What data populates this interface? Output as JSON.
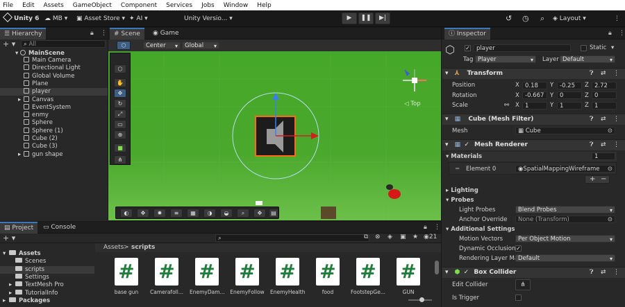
{
  "menu": [
    "File",
    "Edit",
    "Assets",
    "GameObject",
    "Component",
    "Services",
    "Jobs",
    "Window",
    "Help"
  ],
  "toolbar": {
    "unity_label": "Unity 6",
    "account_label": "MB",
    "asset_store_label": "Asset Store",
    "ai_label": "AI",
    "version_label": "Unity Versio...",
    "layout_label": "Layout"
  },
  "hierarchy": {
    "tab": "Hierarchy",
    "search_placeholder": "All",
    "scene_name": "MainScene",
    "items": [
      {
        "label": "Main Camera",
        "expandable": false
      },
      {
        "label": "Directional Light",
        "expandable": false
      },
      {
        "label": "Global Volume",
        "expandable": false
      },
      {
        "label": "Plane",
        "expandable": false
      },
      {
        "label": "player",
        "expandable": false,
        "selected": true
      },
      {
        "label": "Canvas",
        "expandable": true
      },
      {
        "label": "EventSystem",
        "expandable": false
      },
      {
        "label": "enmy",
        "expandable": false
      },
      {
        "label": "Sphere",
        "expandable": false
      },
      {
        "label": "Sphere (1)",
        "expandable": false
      },
      {
        "label": "Cube (2)",
        "expandable": false
      },
      {
        "label": "Cube (3)",
        "expandable": false
      },
      {
        "label": "gun shape",
        "expandable": true
      }
    ]
  },
  "scene": {
    "tab_scene": "Scene",
    "tab_game": "Game",
    "pivot_label": "Center",
    "space_label": "Global",
    "gizmo_view_label": "Top",
    "ground_color": "#4fa72a"
  },
  "project": {
    "tab_project": "Project",
    "tab_console": "Console",
    "tree": [
      {
        "label": "Assets",
        "level": 0,
        "bold": true
      },
      {
        "label": "Scenes",
        "level": 1
      },
      {
        "label": "scripts",
        "level": 1,
        "selected": true
      },
      {
        "label": "Settings",
        "level": 1
      },
      {
        "label": "TextMesh Pro",
        "level": 1
      },
      {
        "label": "TutorialInfo",
        "level": 1
      },
      {
        "label": "Packages",
        "level": 0,
        "bold": true
      }
    ],
    "breadcrumb_root": "Assets",
    "breadcrumb_sep": ">",
    "breadcrumb_current": "scripts",
    "hidden_count": "21",
    "assets": [
      "base gun",
      "Camerafoll...",
      "EnemyDam...",
      "EnemyFollow",
      "EnemyHealth",
      "food",
      "FootstepGe...",
      "GUN"
    ]
  },
  "inspector": {
    "tab": "Inspector",
    "object_name": "player",
    "static_label": "Static",
    "tag_label": "Tag",
    "tag_value": "Player",
    "layer_label": "Layer",
    "layer_value": "Default",
    "transform": {
      "title": "Transform",
      "position_label": "Position",
      "rotation_label": "Rotation",
      "scale_label": "Scale",
      "position": {
        "x": "0.18",
        "y": "-0.25",
        "z": "2.72"
      },
      "rotation": {
        "x": "-0.667",
        "y": "0",
        "z": "0"
      },
      "scale": {
        "x": "1",
        "y": "1",
        "z": "1"
      }
    },
    "mesh_filter": {
      "title": "Cube (Mesh Filter)",
      "mesh_label": "Mesh",
      "mesh_value": "Cube"
    },
    "mesh_renderer": {
      "title": "Mesh Renderer",
      "materials_label": "Materials",
      "materials_count": "1",
      "element_label": "Element 0",
      "element_value": "SpatialMappingWireframe",
      "lighting_label": "Lighting",
      "probes_label": "Probes",
      "light_probes_label": "Light Probes",
      "light_probes_value": "Blend Probes",
      "anchor_label": "Anchor Override",
      "anchor_value": "None (Transform)",
      "additional_label": "Additional Settings",
      "motion_label": "Motion Vectors",
      "motion_value": "Per Object Motion",
      "dynamic_label": "Dynamic Occlusion",
      "layer_mask_label": "Rendering Layer Ma",
      "layer_mask_value": "Default"
    },
    "box_collider": {
      "title": "Box Collider",
      "edit_label": "Edit Collider",
      "trigger_label": "Is Trigger"
    },
    "axis_x": "X",
    "axis_y": "Y",
    "axis_z": "Z",
    "plus": "+",
    "minus": "−"
  }
}
